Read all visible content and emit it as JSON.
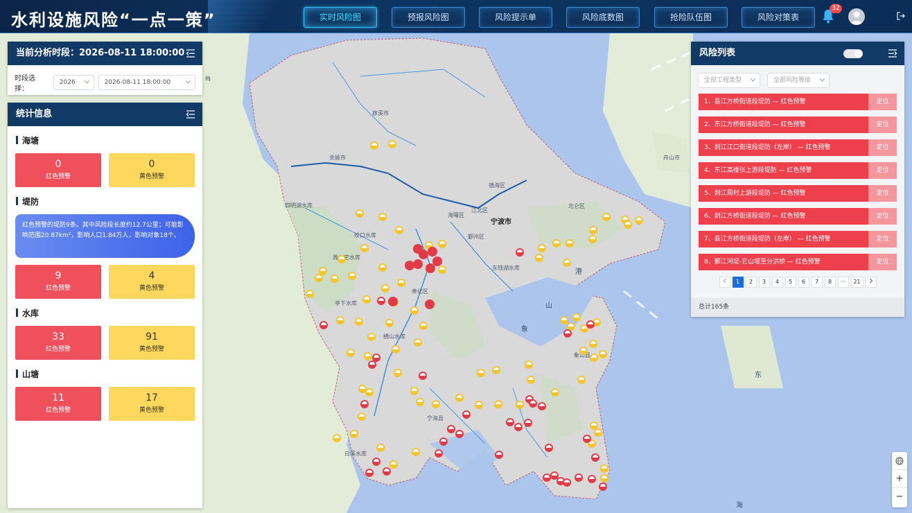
{
  "header": {
    "title": "水利设施风险“一点一策”",
    "nav": [
      "实时风险图",
      "预报风险图",
      "风险提示单",
      "风险底数图",
      "抢险队伍图",
      "风险对策表"
    ],
    "active_nav": "实时风险图",
    "notification_count": "32"
  },
  "time_panel": {
    "title": "当前分析时段：2026-08-11 18:00:00",
    "period_label": "时段选择：",
    "year_value": "2026",
    "datetime_value": "2026-08-11 18:00:00"
  },
  "stats": {
    "title": "统计信息",
    "red_label": "红色预警",
    "yellow_label": "黄色预警",
    "seawall": {
      "name": "海塘",
      "red": "0",
      "yellow": "0"
    },
    "embankment": {
      "name": "堤防",
      "note": "红色预警的堤防9条。其中风险段长度约12.7公里；可能影响范围20.87km²，影响人口1.84万人，影响对象18个。",
      "red": "9",
      "yellow": "4"
    },
    "reservoir": {
      "name": "水库",
      "red": "33",
      "yellow": "91"
    },
    "pond": {
      "name": "山塘",
      "red": "11",
      "yellow": "17"
    }
  },
  "risk_list": {
    "title": "风险列表",
    "filter_type_placeholder": "全部工程类型",
    "filter_level_placeholder": "全部风险等级",
    "locate_label": "定位",
    "items": [
      "1、县江方桥街道段堤防 — 红色预警",
      "2、东江方桥街道段堤防 — 红色预警",
      "3、剡江江口街道段堤防（左岸） — 红色预警",
      "4、东江高楼张上游段堤防 — 红色预警",
      "5、剡江周村上游段堤防 — 红色预警",
      "6、剡江方桥街道段堤防 — 红色预警",
      "7、县江方桥街道段堤防（左岸） — 红色预警",
      "8、鄞江河堤-它山堰至分洪桥 — 红色预警"
    ],
    "pages": [
      "1",
      "2",
      "3",
      "4",
      "5",
      "6",
      "7",
      "8",
      "···",
      "21"
    ],
    "active_page": "1",
    "total": "总计165条"
  },
  "map": {
    "labels": [
      {
        "text": "宁波市",
        "kind": "city"
      },
      {
        "text": "象",
        "kind": "sea"
      },
      {
        "text": "山",
        "kind": "sea"
      },
      {
        "text": "港",
        "kind": "sea"
      },
      {
        "text": "东",
        "kind": "sea"
      },
      {
        "text": "海",
        "kind": "sea"
      },
      {
        "text": "舟山市",
        "kind": "small"
      },
      {
        "text": "四明湖水库",
        "kind": "small"
      },
      {
        "text": "皎口水库",
        "kind": "small"
      },
      {
        "text": "周公宅水库",
        "kind": "small"
      },
      {
        "text": "亭下水库",
        "kind": "small"
      },
      {
        "text": "横山水库",
        "kind": "small"
      },
      {
        "text": "白溪水库",
        "kind": "small"
      },
      {
        "text": "东钱湖水库",
        "kind": "small"
      },
      {
        "text": "余姚市",
        "kind": "small"
      },
      {
        "text": "慈溪市",
        "kind": "small"
      },
      {
        "text": "镇海区",
        "kind": "small"
      },
      {
        "text": "北仑区",
        "kind": "small"
      },
      {
        "text": "海曙区",
        "kind": "small"
      },
      {
        "text": "鄞州区",
        "kind": "small"
      },
      {
        "text": "奉化区",
        "kind": "small"
      },
      {
        "text": "宁海县",
        "kind": "small"
      },
      {
        "text": "象山县",
        "kind": "small"
      },
      {
        "text": "江北区",
        "kind": "small"
      },
      {
        "text": "梅",
        "kind": "small"
      }
    ]
  }
}
